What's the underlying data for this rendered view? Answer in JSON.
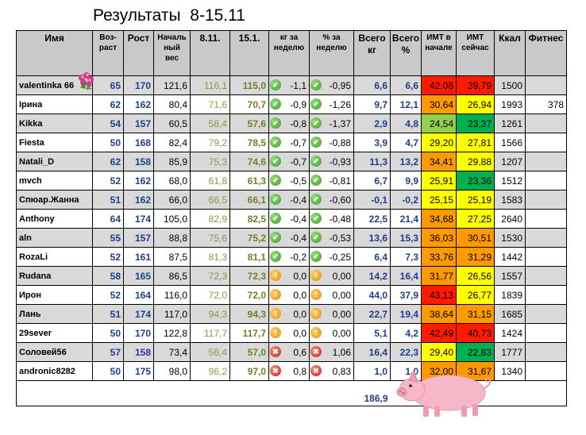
{
  "title": "Результаты  8-15.11",
  "headers": {
    "name": "Имя",
    "age": "Воз-\nраст",
    "height": "Рост",
    "initial_weight": "Началь\nный\nвес",
    "w1": "8.11.",
    "w2": "15.1.",
    "kg_week": "кг за\nнеделю",
    "pct_week": "% за\nнеделю",
    "total_kg": "Всего\nкг",
    "total_pct": "Всего\n%",
    "bmi_start": "ИМТ в\nначале",
    "bmi_now": "ИМТ\nсейчас",
    "kcal": "Ккал",
    "fitness": "Фитнес"
  },
  "rows": [
    {
      "name": "valentinka 66",
      "age": "65",
      "height": "170",
      "initial": "121,6",
      "w1": "116,1",
      "w2": "115,0",
      "kg": "-1,1",
      "kg_icon": "check-icon",
      "pct": "-0,95",
      "pct_icon": "check-icon",
      "total_kg": "6,6",
      "total_pct": "6,6",
      "bmi_start": "42,08",
      "bmi_now": "39,79",
      "kcal": "1500",
      "fitness": ""
    },
    {
      "name": "Ірина",
      "age": "62",
      "height": "162",
      "initial": "80,4",
      "w1": "71,6",
      "w2": "70,7",
      "kg": "-0,9",
      "kg_icon": "check-icon",
      "pct": "-1,26",
      "pct_icon": "check-icon",
      "total_kg": "9,7",
      "total_pct": "12,1",
      "bmi_start": "30,64",
      "bmi_now": "26,94",
      "kcal": "1993",
      "fitness": "378"
    },
    {
      "name": "Kikka",
      "age": "54",
      "height": "157",
      "initial": "60,5",
      "w1": "58,4",
      "w2": "57,6",
      "kg": "-0,8",
      "kg_icon": "check-icon",
      "pct": "-1,37",
      "pct_icon": "check-icon",
      "total_kg": "2,9",
      "total_pct": "4,8",
      "bmi_start": "24,54",
      "bmi_now": "23,37",
      "kcal": "1261",
      "fitness": ""
    },
    {
      "name": "Fiesta",
      "age": "50",
      "height": "168",
      "initial": "82,4",
      "w1": "79,2",
      "w2": "78,5",
      "kg": "-0,7",
      "kg_icon": "check-icon",
      "pct": "-0,88",
      "pct_icon": "check-icon",
      "total_kg": "3,9",
      "total_pct": "4,7",
      "bmi_start": "29,20",
      "bmi_now": "27,81",
      "kcal": "1566",
      "fitness": ""
    },
    {
      "name": "Natali_D",
      "age": "62",
      "height": "158",
      "initial": "85,9",
      "w1": "75,3",
      "w2": "74,6",
      "kg": "-0,7",
      "kg_icon": "check-icon",
      "pct": "-0,93",
      "pct_icon": "check-icon",
      "total_kg": "11,3",
      "total_pct": "13,2",
      "bmi_start": "34,41",
      "bmi_now": "29,88",
      "kcal": "1207",
      "fitness": ""
    },
    {
      "name": "mvch",
      "age": "52",
      "height": "162",
      "initial": "68,0",
      "w1": "61,8",
      "w2": "61,3",
      "kg": "-0,5",
      "kg_icon": "check-icon",
      "pct": "-0,81",
      "pct_icon": "check-icon",
      "total_kg": "6,7",
      "total_pct": "9,9",
      "bmi_start": "25,91",
      "bmi_now": "23,36",
      "kcal": "1512",
      "fitness": ""
    },
    {
      "name": "Спюар.Жанна",
      "age": "51",
      "height": "162",
      "initial": "66,0",
      "w1": "66,5",
      "w2": "66,1",
      "kg": "-0,4",
      "kg_icon": "check-icon",
      "pct": "-0,60",
      "pct_icon": "check-icon",
      "total_kg": "-0,1",
      "total_pct": "-0,2",
      "bmi_start": "25,15",
      "bmi_now": "25,19",
      "kcal": "1583",
      "fitness": ""
    },
    {
      "name": "Anthony",
      "age": "64",
      "height": "174",
      "initial": "105,0",
      "w1": "82,9",
      "w2": "82,5",
      "kg": "-0,4",
      "kg_icon": "check-icon",
      "pct": "-0,48",
      "pct_icon": "check-icon",
      "total_kg": "22,5",
      "total_pct": "21,4",
      "bmi_start": "34,68",
      "bmi_now": "27,25",
      "kcal": "2640",
      "fitness": ""
    },
    {
      "name": "aln",
      "age": "55",
      "height": "157",
      "initial": "88,8",
      "w1": "75,6",
      "w2": "75,2",
      "kg": "-0,4",
      "kg_icon": "check-icon",
      "pct": "-0,53",
      "pct_icon": "check-icon",
      "total_kg": "13,6",
      "total_pct": "15,3",
      "bmi_start": "36,03",
      "bmi_now": "30,51",
      "kcal": "1530",
      "fitness": ""
    },
    {
      "name": "RozaLi",
      "age": "52",
      "height": "161",
      "initial": "87,5",
      "w1": "81,3",
      "w2": "81,1",
      "kg": "-0,2",
      "kg_icon": "check-icon",
      "pct": "-0,25",
      "pct_icon": "check-icon",
      "total_kg": "6,4",
      "total_pct": "7,3",
      "bmi_start": "33,76",
      "bmi_now": "31,29",
      "kcal": "1442",
      "fitness": ""
    },
    {
      "name": "Rudana",
      "age": "58",
      "height": "165",
      "initial": "86,5",
      "w1": "72,3",
      "w2": "72,3",
      "kg": "0,0",
      "kg_icon": "warning-icon",
      "pct": "0,00",
      "pct_icon": "warning-icon",
      "total_kg": "14,2",
      "total_pct": "16,4",
      "bmi_start": "31,77",
      "bmi_now": "26,56",
      "kcal": "1557",
      "fitness": ""
    },
    {
      "name": "Ирон",
      "age": "52",
      "height": "164",
      "initial": "116,0",
      "w1": "72,0",
      "w2": "72,0",
      "kg": "0,0",
      "kg_icon": "warning-icon",
      "pct": "0,00",
      "pct_icon": "warning-icon",
      "total_kg": "44,0",
      "total_pct": "37,9",
      "bmi_start": "43,13",
      "bmi_now": "26,77",
      "kcal": "1839",
      "fitness": ""
    },
    {
      "name": "Лань",
      "age": "51",
      "height": "174",
      "initial": "117,0",
      "w1": "94,3",
      "w2": "94,3",
      "kg": "0,0",
      "kg_icon": "warning-icon",
      "pct": "0,00",
      "pct_icon": "warning-icon",
      "total_kg": "22,7",
      "total_pct": "19,4",
      "bmi_start": "38,64",
      "bmi_now": "31,15",
      "kcal": "1685",
      "fitness": ""
    },
    {
      "name": "29sever",
      "age": "50",
      "height": "170",
      "initial": "122,8",
      "w1": "117,7",
      "w2": "117,7",
      "kg": "0,0",
      "kg_icon": "warning-icon",
      "pct": "0,00",
      "pct_icon": "warning-icon",
      "total_kg": "5,1",
      "total_pct": "4,2",
      "bmi_start": "42,49",
      "bmi_now": "40,73",
      "kcal": "1424",
      "fitness": ""
    },
    {
      "name": "Соловей56",
      "age": "57",
      "height": "158",
      "initial": "73,4",
      "w1": "56,4",
      "w2": "57,0",
      "kg": "0,6",
      "kg_icon": "cross-icon",
      "pct": "1,06",
      "pct_icon": "cross-icon",
      "total_kg": "16,4",
      "total_pct": "22,3",
      "bmi_start": "29,40",
      "bmi_now": "22,83",
      "kcal": "1777",
      "fitness": ""
    },
    {
      "name": "andronic8282",
      "age": "50",
      "height": "175",
      "initial": "98,0",
      "w1": "96,2",
      "w2": "97,0",
      "kg": "0,8",
      "kg_icon": "cross-icon",
      "pct": "0,83",
      "pct_icon": "cross-icon",
      "total_kg": "1,0",
      "total_pct": "1,0",
      "bmi_start": "32,00",
      "bmi_now": "31,67",
      "kcal": "1340",
      "fitness": ""
    }
  ],
  "total": "186,9",
  "bmi_colors": {
    "red": "#ff1a00",
    "orange": "#ff9900",
    "yellow": "#ffff00",
    "lime": "#92d050",
    "green": "#00b050"
  },
  "decorations": [
    "flower-icon",
    "pig-icon"
  ]
}
